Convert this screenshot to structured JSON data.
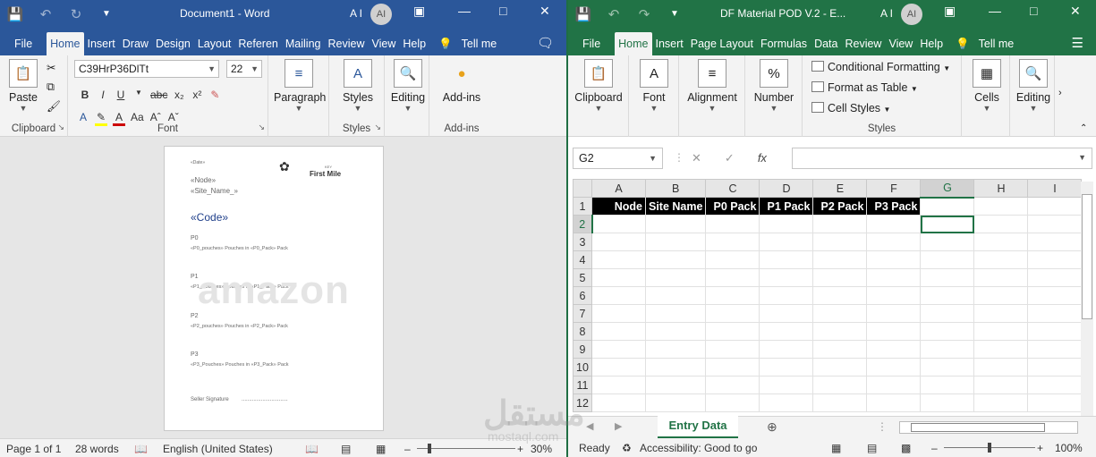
{
  "word": {
    "title": "Document1  -  Word",
    "user_initials_label": "A I",
    "avatar": "AI",
    "tabs": [
      "File",
      "Home",
      "Insert",
      "Draw",
      "Design",
      "Layout",
      "Referen",
      "Mailing",
      "Review",
      "View",
      "Help"
    ],
    "tell_me": "Tell me",
    "ribbon": {
      "paste": "Paste",
      "clipboard": "Clipboard",
      "font_name": "C39HrP36DlTt",
      "font_size": "22",
      "font_group": "Font",
      "paragraph": "Paragraph",
      "styles": "Styles",
      "styles_group": "Styles",
      "editing": "Editing",
      "addins": "Add-ins",
      "addins_group": "Add-ins"
    },
    "page": {
      "date": "«Date»",
      "brand_top": "KEY",
      "brand": "First Mile",
      "node": "«Node»",
      "site": "«Site_Name_»",
      "code": "«Code»",
      "p0": "P0",
      "p0_line": "«P0_pouches» Pouches in «P0_Pack» Pack",
      "p1": "P1",
      "p1_line": "«P1_Pouches» Pouches in «P1_Pack» Pack",
      "p2": "P2",
      "p2_line": "«P2_pouches» Pouches in «P2_Pack» Pack",
      "p3": "P3",
      "p3_line": "«P3_Pouches» Pouches in «P3_Pack» Pack",
      "signature": "Seller Signature",
      "signature_line": "...............................",
      "watermark": "amazon"
    },
    "status": {
      "page": "Page 1 of 1",
      "words": "28 words",
      "language": "English (United States)",
      "zoom": "30%"
    }
  },
  "excel": {
    "title": "DF Material POD V.2  -  E...",
    "user_initials_label": "A I",
    "avatar": "AI",
    "tabs": [
      "File",
      "Home",
      "Insert",
      "Page Layout",
      "Formulas",
      "Data",
      "Review",
      "View",
      "Help"
    ],
    "tell_me": "Tell me",
    "ribbon": {
      "clipboard": "Clipboard",
      "font": "Font",
      "alignment": "Alignment",
      "number": "Number",
      "conditional": "Conditional Formatting",
      "format_table": "Format as Table",
      "cell_styles": "Cell Styles",
      "styles_group": "Styles",
      "cells": "Cells",
      "editing": "Editing"
    },
    "name_box": "G2",
    "fx": "fx",
    "columns": [
      "A",
      "B",
      "C",
      "D",
      "E",
      "F",
      "G",
      "H",
      "I"
    ],
    "rows": [
      "1",
      "2",
      "3",
      "4",
      "5",
      "6",
      "7",
      "8",
      "9",
      "10",
      "11",
      "12"
    ],
    "headers": [
      "Node",
      "Site Name",
      "P0 Pack",
      "P1 Pack",
      "P2 Pack",
      "P3 Pack"
    ],
    "sheet_tab": "Entry Data",
    "status": {
      "ready": "Ready",
      "accessibility": "Accessibility: Good to go",
      "zoom": "100%"
    },
    "watermark": "مستقل",
    "watermark_sub": "mostaql.com"
  }
}
